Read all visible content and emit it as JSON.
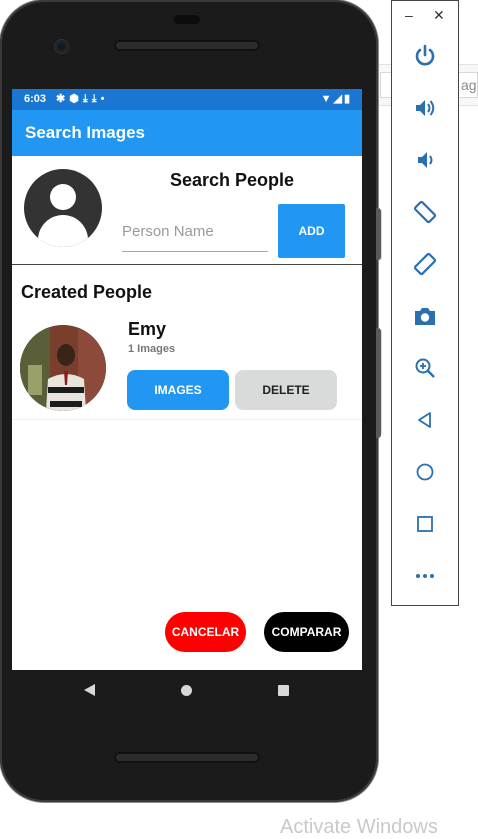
{
  "host": {
    "field_partial_text": "age",
    "watermark": "Activate Windows"
  },
  "status_bar": {
    "time": "6:03",
    "left_icons": [
      "gear-icon",
      "shield-icon",
      "download-icon",
      "download-icon",
      "dot-icon"
    ],
    "right_icons": [
      "wifi-icon",
      "signal-icon",
      "battery-icon"
    ]
  },
  "app_bar": {
    "title": "Search Images"
  },
  "search": {
    "title": "Search People",
    "input_placeholder": "Person Name",
    "input_value": "",
    "add_label": "ADD"
  },
  "created": {
    "title": "Created People",
    "people": [
      {
        "name": "Emy",
        "count": "1 Images",
        "images_label": "IMAGES",
        "delete_label": "DELETE"
      }
    ]
  },
  "footer": {
    "cancel_label": "CANCELAR",
    "compare_label": "COMPARAR"
  },
  "emulator": {
    "minimize": "–",
    "close": "✕",
    "tools": [
      "power-icon",
      "volume-up-icon",
      "volume-down-icon",
      "rotate-left-icon",
      "rotate-right-icon",
      "camera-icon",
      "zoom-in-icon",
      "back-icon",
      "home-icon",
      "overview-icon",
      "more-icon"
    ]
  },
  "colors": {
    "status_bar": "#1976d2",
    "app_bar": "#2196f3",
    "primary_button": "#2196f3",
    "delete_button": "#d9dbdb",
    "cancel_button": "#ff0000",
    "compare_button": "#000000"
  }
}
